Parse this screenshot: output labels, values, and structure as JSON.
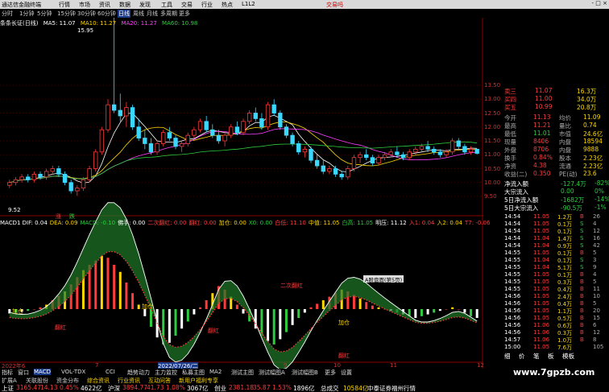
{
  "window": {
    "title": "通达信金融终端",
    "menu": [
      "行情",
      "市场",
      "资讯",
      "数据",
      "发现",
      "工具",
      "交易",
      "行业",
      "热点",
      "L1L2"
    ],
    "trade_label": "交易吗",
    "win_buttons": [
      "-",
      "□",
      "×"
    ]
  },
  "periods": [
    "分时",
    "1分钟",
    "5分钟",
    "15分钟",
    "30分钟",
    "60分钟",
    "日线",
    "周线",
    "月线",
    "多周期",
    "更多"
  ],
  "active_period": "日线",
  "chart": {
    "stock_name": "条条长证(日线)",
    "ma_legend": [
      {
        "label": "MA5: 11.07",
        "color": "#ffffff"
      },
      {
        "label": "MA10: 11.27",
        "color": "#ffd800"
      },
      {
        "label": "MA20: 11.27",
        "color": "#ff40ff"
      },
      {
        "label": "MA60: 10.98",
        "color": "#2ecc40"
      }
    ],
    "high_label": "15.95",
    "low_label": "9.52",
    "price_ticks": [
      "13.50",
      "13.00",
      "12.50",
      "12.00",
      "11.50",
      "11.00",
      "10.50",
      "10.00",
      "9.50"
    ],
    "ind_legend": [
      {
        "label": "MACD1 DIF: 0.04",
        "color": "#ffffff"
      },
      {
        "label": "DEA: 0.09",
        "color": "#ffd800"
      },
      {
        "label": "MACD: -0.10",
        "color": "#2ecc40"
      },
      {
        "label": "佛手: 0.00",
        "color": "#ffffff"
      },
      {
        "label": "二次翻红: 0.00",
        "color": "#ff3b3b"
      },
      {
        "label": "翻红: 0.00",
        "color": "#ff3b3b"
      },
      {
        "label": "加仓: 0.00",
        "color": "#ffd800"
      },
      {
        "label": "X0: 0.00",
        "color": "#2ecc40"
      },
      {
        "label": "白低: 11.10",
        "color": "#ff3b3b"
      },
      {
        "label": "中值: 11.05",
        "color": "#ffd800"
      },
      {
        "label": "白高: 11.05",
        "color": "#2ecc40"
      },
      {
        "label": "明压: 11.12",
        "color": "#ffffff"
      },
      {
        "label": "入1: 0.04",
        "color": "#ff3b3b"
      },
      {
        "label": "入2: 0.04",
        "color": "#ffd800"
      },
      {
        "label": "T7: -0.06",
        "color": "#ff3b3b"
      }
    ],
    "annotations": [
      {
        "text": "加仓",
        "color": "#ffd800"
      },
      {
        "text": "翻红",
        "color": "#ff3b3b"
      },
      {
        "text": "加仓",
        "color": "#ffd800"
      },
      {
        "text": "翻红",
        "color": "#ff3b3b"
      },
      {
        "text": "二次翻红",
        "color": "#ff3b3b"
      },
      {
        "text": "加仓",
        "color": "#ffd800"
      },
      {
        "text": "翻红",
        "color": "#ff3b3b"
      }
    ],
    "popup_label": "A股盘面(第5页)",
    "markers": [
      "涨",
      "跌"
    ],
    "date_labels": [
      "2022年6",
      "7",
      "2022/07/26/二",
      "9",
      "10",
      "11",
      "12"
    ]
  },
  "quote": {
    "order_book": [
      {
        "label": "卖三",
        "price": "11.07",
        "vol": "16.3万"
      },
      {
        "label": "买四",
        "price": "11.00",
        "vol": "34.0万"
      },
      {
        "label": "买五",
        "price": "10.99",
        "vol": "20.8万"
      }
    ],
    "stats": [
      {
        "l1": "今开",
        "v1": "11.13",
        "l2": "均价",
        "v2": "11.09"
      },
      {
        "l1": "最高",
        "v1": "11.21",
        "l2": "量比",
        "v2": "0.74"
      },
      {
        "l1": "最低",
        "v1": "11.01",
        "l2": "市值",
        "v2": "24.6亿"
      },
      {
        "l1": "现量",
        "v1": "8406",
        "l2": "内盘",
        "v2": "18594"
      },
      {
        "l1": "外盘",
        "v1": "8706",
        "l2": "内盘",
        "v2": "9888"
      },
      {
        "l1": "换手",
        "v1": "0.84%",
        "l2": "股本",
        "v2": "2.23亿"
      },
      {
        "l1": "净资",
        "v1": "4.38",
        "l2": "流通",
        "v2": "2.23亿"
      },
      {
        "l1": "收益(二)",
        "v1": "0.350",
        "l2": "PE(动)",
        "v2": "23.6"
      }
    ],
    "flows": [
      {
        "label": "净流入额",
        "value": "-127.4万",
        "pct": "-82%"
      },
      {
        "label": "大宗流入",
        "value": "0.00",
        "pct": "0%"
      },
      {
        "label": "5日净流入额",
        "value": "-1682万",
        "pct": "-14%"
      },
      {
        "label": "5日大宗流入",
        "value": "-90.5万",
        "pct": "-1%"
      }
    ],
    "trades": [
      {
        "time": "14:54",
        "price": "11.05",
        "vol": "1.2万",
        "n": "B",
        "d": "26"
      },
      {
        "time": "14:54",
        "price": "11.05",
        "vol": "0.1万",
        "n": "S",
        "d": "4"
      },
      {
        "time": "14:54",
        "price": "11.05",
        "vol": "0.1万",
        "n": "S",
        "d": "12"
      },
      {
        "time": "14:54",
        "price": "11.04",
        "vol": "1.4万",
        "n": "S",
        "d": "16"
      },
      {
        "time": "14:54",
        "price": "11.04",
        "vol": "0.9万",
        "n": "S",
        "d": "42"
      },
      {
        "time": "14:55",
        "price": "11.05",
        "vol": "0.1万",
        "n": "B",
        "d": "5"
      },
      {
        "time": "14:55",
        "price": "11.04",
        "vol": "0.1万",
        "n": "S",
        "d": "3"
      },
      {
        "time": "14:55",
        "price": "11.04",
        "vol": "5.1万",
        "n": "S",
        "d": "9"
      },
      {
        "time": "14:55",
        "price": "11.05",
        "vol": "0.1万",
        "n": "B",
        "d": "4"
      },
      {
        "time": "14:55",
        "price": "11.05",
        "vol": "0.3万",
        "n": "B",
        "d": "5"
      },
      {
        "time": "14:55",
        "price": "11.05",
        "vol": "0.4万",
        "n": "B",
        "d": "11"
      },
      {
        "time": "14:56",
        "price": "11.05",
        "vol": "2.4万",
        "n": "B",
        "d": "10"
      },
      {
        "time": "14:56",
        "price": "11.05",
        "vol": "0.4万",
        "n": "B",
        "d": "5"
      },
      {
        "time": "14:56",
        "price": "11.05",
        "vol": "1.1万",
        "n": "B",
        "d": "20"
      },
      {
        "time": "14:56",
        "price": "11.05",
        "vol": "0.5万",
        "n": "B",
        "d": "15"
      },
      {
        "time": "14:56",
        "price": "11.06",
        "vol": "0.6万",
        "n": "B",
        "d": "6"
      },
      {
        "time": "14:56",
        "price": "11.06",
        "vol": "0.3万",
        "n": "B",
        "d": "12"
      },
      {
        "time": "14:57",
        "price": "11.06",
        "vol": "1.0万",
        "n": "B",
        "d": "8"
      },
      {
        "time": "15:00",
        "price": "11.05",
        "vol": "7.6万",
        "n": "",
        "d": "105"
      }
    ],
    "tabs": [
      "细",
      "价",
      "笔",
      "板",
      "模板"
    ]
  },
  "bottom_tabs": [
    "指标",
    "窗口",
    "MACD",
    "VOL-TDX",
    "CCI",
    "趋势动力",
    "主力监控",
    "私募主图",
    "MA2",
    "测试主图",
    "测试幅图A",
    "测试幅图B",
    "更多",
    "设置"
  ],
  "active_bottom_tab": "MACD",
  "sub_tabs": [
    "扩展A",
    "关联股份",
    "资金分布",
    "综合资讯",
    "行业资讯",
    "互动问答",
    "新用户福利专享"
  ],
  "status": [
    {
      "label": "上证",
      "value": "3165.47",
      "chg": "14.13",
      "pct": "0.45%",
      "amt": "4622亿"
    },
    {
      "label": "沪深",
      "value": "3894.77",
      "chg": "41.73",
      "pct": "1.08%",
      "amt": "3067亿"
    },
    {
      "label": "创业",
      "value": "2381.18",
      "chg": "35.87",
      "pct": "1.53%",
      "amt": "1896亿"
    }
  ],
  "status_extra": "总成交",
  "status_total": "10584亿",
  "status_tip": "中泰证券福州行情",
  "watermark": "www.7gpzb.com",
  "chart_data": {
    "type": "candlestick",
    "title": "条条长证(日线)",
    "ylim": [
      9.5,
      13.5
    ],
    "candles": [
      [
        9.9,
        10.1,
        9.8,
        10.0
      ],
      [
        10.0,
        10.2,
        9.9,
        10.1
      ],
      [
        10.1,
        10.3,
        10.0,
        10.2
      ],
      [
        10.2,
        10.3,
        10.0,
        10.1
      ],
      [
        10.1,
        10.4,
        10.0,
        10.3
      ],
      [
        10.3,
        10.4,
        10.1,
        10.2
      ],
      [
        10.2,
        10.5,
        10.1,
        10.4
      ],
      [
        10.4,
        10.6,
        10.3,
        10.5
      ],
      [
        10.5,
        10.6,
        10.2,
        10.3
      ],
      [
        10.3,
        10.4,
        9.9,
        10.0
      ],
      [
        10.0,
        10.1,
        9.6,
        9.7
      ],
      [
        9.7,
        9.9,
        9.52,
        9.8
      ],
      [
        9.8,
        10.2,
        9.7,
        10.1
      ],
      [
        10.1,
        10.6,
        10.0,
        10.5
      ],
      [
        10.5,
        11.2,
        10.4,
        11.1
      ],
      [
        11.1,
        12.0,
        11.0,
        11.9
      ],
      [
        11.9,
        13.0,
        11.8,
        12.8
      ],
      [
        12.8,
        15.95,
        12.5,
        12.6
      ],
      [
        12.6,
        13.2,
        12.2,
        12.4
      ],
      [
        12.4,
        12.9,
        12.0,
        12.7
      ],
      [
        12.7,
        12.8,
        11.9,
        12.0
      ],
      [
        12.0,
        12.3,
        11.5,
        11.6
      ],
      [
        11.6,
        11.9,
        11.2,
        11.4
      ],
      [
        11.4,
        11.6,
        11.0,
        11.1
      ],
      [
        11.1,
        11.5,
        11.0,
        11.4
      ],
      [
        11.4,
        11.9,
        11.3,
        11.8
      ],
      [
        11.8,
        12.0,
        11.5,
        11.6
      ],
      [
        11.6,
        11.7,
        11.2,
        11.3
      ],
      [
        11.3,
        11.5,
        11.1,
        11.4
      ],
      [
        11.4,
        11.8,
        11.3,
        11.7
      ],
      [
        11.7,
        12.0,
        11.6,
        11.9
      ],
      [
        11.9,
        12.3,
        11.8,
        12.2
      ],
      [
        12.2,
        12.4,
        11.8,
        11.9
      ],
      [
        11.9,
        12.1,
        11.6,
        11.7
      ],
      [
        11.7,
        11.9,
        11.4,
        11.5
      ],
      [
        11.5,
        11.8,
        11.3,
        11.7
      ],
      [
        11.7,
        12.1,
        11.6,
        12.0
      ],
      [
        12.0,
        12.2,
        11.7,
        11.8
      ],
      [
        11.8,
        12.3,
        11.7,
        12.2
      ],
      [
        12.2,
        12.6,
        12.1,
        12.5
      ],
      [
        12.5,
        12.7,
        12.2,
        12.3
      ],
      [
        12.3,
        12.5,
        11.9,
        12.0
      ],
      [
        12.0,
        12.9,
        11.9,
        12.8
      ],
      [
        12.8,
        13.0,
        12.4,
        12.5
      ],
      [
        12.5,
        12.6,
        11.9,
        12.0
      ],
      [
        12.0,
        12.1,
        11.6,
        11.7
      ],
      [
        11.7,
        11.8,
        11.3,
        11.4
      ],
      [
        11.4,
        11.5,
        11.0,
        11.1
      ],
      [
        11.1,
        11.3,
        10.9,
        11.2
      ],
      [
        11.2,
        11.3,
        10.7,
        10.8
      ],
      [
        10.8,
        11.0,
        10.5,
        10.6
      ],
      [
        10.6,
        10.8,
        10.3,
        10.4
      ],
      [
        10.4,
        10.6,
        10.3,
        10.5
      ],
      [
        10.5,
        10.6,
        10.2,
        10.3
      ],
      [
        10.3,
        10.4,
        10.1,
        10.2
      ],
      [
        10.2,
        10.6,
        10.1,
        10.5
      ],
      [
        10.5,
        11.0,
        10.4,
        10.9
      ],
      [
        10.9,
        11.1,
        10.7,
        11.0
      ],
      [
        11.0,
        11.2,
        10.8,
        10.9
      ],
      [
        10.9,
        11.0,
        10.6,
        10.7
      ],
      [
        10.7,
        11.0,
        10.6,
        10.9
      ],
      [
        10.9,
        11.1,
        10.8,
        11.0
      ],
      [
        11.0,
        11.2,
        10.9,
        11.1
      ],
      [
        11.1,
        11.3,
        10.9,
        11.0
      ],
      [
        11.0,
        11.1,
        10.8,
        10.9
      ],
      [
        10.9,
        11.2,
        10.8,
        11.1
      ],
      [
        11.1,
        11.3,
        11.0,
        11.2
      ],
      [
        11.2,
        11.4,
        11.1,
        11.3
      ],
      [
        11.3,
        11.5,
        11.1,
        11.2
      ],
      [
        11.2,
        11.3,
        11.0,
        11.1
      ],
      [
        11.1,
        11.2,
        10.9,
        11.0
      ],
      [
        11.0,
        11.2,
        10.9,
        11.1
      ],
      [
        11.1,
        11.6,
        11.0,
        11.5
      ],
      [
        11.5,
        11.6,
        11.2,
        11.3
      ],
      [
        11.3,
        11.4,
        11.0,
        11.1
      ],
      [
        11.1,
        11.3,
        11.0,
        11.2
      ],
      [
        11.2,
        11.21,
        11.01,
        11.05
      ]
    ],
    "macd": [
      -0.05,
      -0.04,
      -0.03,
      -0.02,
      0.0,
      0.02,
      0.05,
      0.1,
      0.15,
      0.2,
      0.28,
      0.36,
      0.44,
      0.5,
      0.55,
      0.6,
      0.58,
      0.5,
      0.42,
      0.3,
      0.18,
      0.05,
      -0.08,
      -0.2,
      -0.32,
      -0.4,
      -0.38,
      -0.3,
      -0.22,
      -0.14,
      -0.06,
      0.02,
      0.1,
      0.18,
      0.26,
      0.22,
      0.14,
      0.05,
      -0.05,
      -0.14,
      -0.22,
      -0.3,
      -0.36,
      -0.4,
      -0.34,
      -0.26,
      -0.18,
      -0.1,
      -0.04,
      0.02,
      0.06,
      0.1,
      0.14,
      0.18,
      0.22,
      0.2,
      0.16,
      0.12,
      0.08,
      0.04,
      0.02,
      0.0,
      -0.02,
      -0.04,
      -0.06,
      -0.08,
      -0.1,
      -0.08,
      -0.06,
      -0.04,
      -0.02,
      0.0,
      0.02,
      0.0,
      -0.04,
      -0.08,
      -0.1
    ]
  }
}
